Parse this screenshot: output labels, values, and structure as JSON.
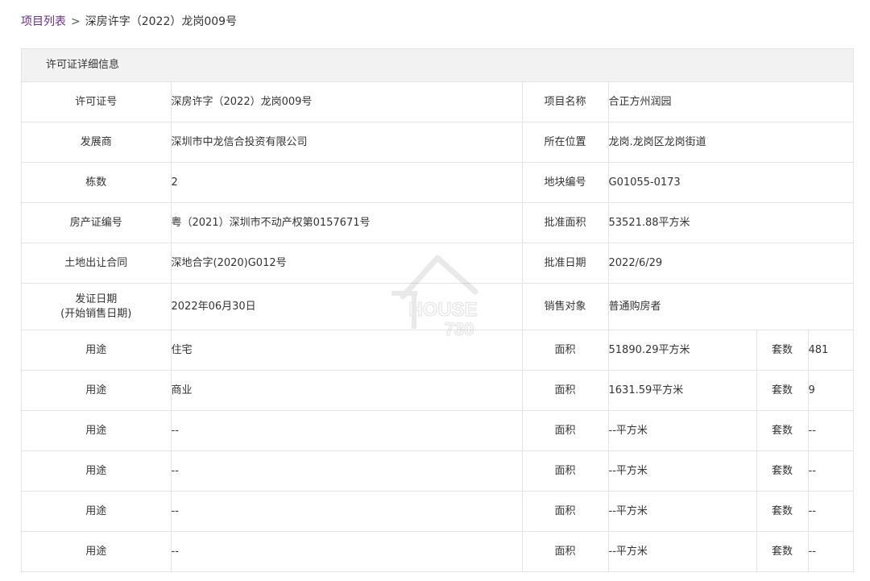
{
  "breadcrumb": {
    "root": "项目列表",
    "separator": ">",
    "current": "深房许字（2022）龙岗009号"
  },
  "panel_title": "许可证详细信息",
  "rows": [
    {
      "l1": "许可证号",
      "v1": "深房许字（2022）龙岗009号",
      "l2": "项目名称",
      "v2": "合正方州润园"
    },
    {
      "l1": "发展商",
      "v1": "深圳市中龙信合投资有限公司",
      "l2": "所在位置",
      "v2": "龙岗.龙岗区龙岗街道"
    },
    {
      "l1": "栋数",
      "v1": "2",
      "l2": "地块编号",
      "v2": "G01055-0173"
    },
    {
      "l1": "房产证编号",
      "v1": "粤（2021）深圳市不动产权第0157671号",
      "l2": "批准面积",
      "v2": "53521.88平方米"
    },
    {
      "l1": "土地出让合同",
      "v1": "深地合字(2020)G012号",
      "l2": "批准日期",
      "v2": "2022/6/29"
    },
    {
      "l1a": "发证日期",
      "l1b": "(开始销售日期)",
      "v1": "2022年06月30日",
      "l2": "销售对象",
      "v2": "普通购房者"
    }
  ],
  "usage_rows": [
    {
      "label": "用途",
      "use": "住宅",
      "area_label": "面积",
      "area": "51890.29平方米",
      "count_label": "套数",
      "count": "481"
    },
    {
      "label": "用途",
      "use": "商业",
      "area_label": "面积",
      "area": "1631.59平方米",
      "count_label": "套数",
      "count": "9"
    },
    {
      "label": "用途",
      "use": "--",
      "area_label": "面积",
      "area": "--平方米",
      "count_label": "套数",
      "count": "--"
    },
    {
      "label": "用途",
      "use": "--",
      "area_label": "面积",
      "area": "--平方米",
      "count_label": "套数",
      "count": "--"
    },
    {
      "label": "用途",
      "use": "--",
      "area_label": "面积",
      "area": "--平方米",
      "count_label": "套数",
      "count": "--"
    },
    {
      "label": "用途",
      "use": "--",
      "area_label": "面积",
      "area": "--平方米",
      "count_label": "套数",
      "count": "--"
    }
  ],
  "watermark": {
    "line1": "HOUSE",
    "line2": "730"
  },
  "colors": {
    "link": "#6c2d8b",
    "header_bg": "#f2f2f2",
    "border": "#e3e3e3",
    "text": "#333333"
  }
}
